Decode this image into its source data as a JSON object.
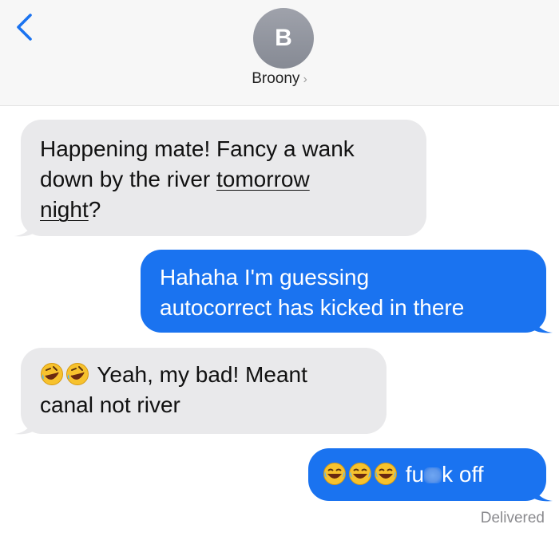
{
  "header": {
    "avatar_letter": "B",
    "contact_name": "Broony",
    "contact_chevron": "›",
    "back_icon": "chevron-left-icon"
  },
  "messages": [
    {
      "from": "them",
      "lines": [
        "Happening mate! Fancy a wank",
        "down by the river ",
        "tomorrow",
        "night",
        "?"
      ]
    },
    {
      "from": "me",
      "lines": [
        "Hahaha I'm guessing",
        "autocorrect has kicked in there"
      ]
    },
    {
      "from": "them",
      "emoji": [
        "rolling-on-floor-laughing-emoji",
        "rolling-on-floor-laughing-emoji"
      ],
      "lines": [
        "Yeah, my bad! Meant",
        "canal not river"
      ]
    },
    {
      "from": "me",
      "emoji": [
        "tears-of-joy-emoji",
        "tears-of-joy-emoji",
        "tears-of-joy-emoji"
      ],
      "text_before": "fu",
      "text_after": "k off"
    }
  ],
  "status": "Delivered",
  "colors": {
    "sent_bubble": "#1a73f0",
    "received_bubble": "#e9e9eb",
    "header_bg": "#f7f7f7",
    "back_accent": "#1a73f0"
  }
}
